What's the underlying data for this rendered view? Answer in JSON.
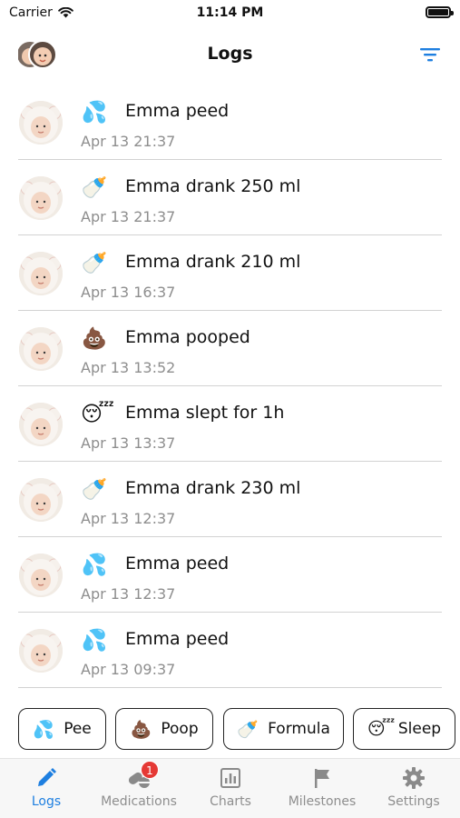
{
  "status_bar": {
    "carrier": "Carrier",
    "time": "11:14 PM"
  },
  "header": {
    "title": "Logs",
    "profile_icon": "baby-avatar-icon",
    "filter_icon": "filter-icon"
  },
  "logs": [
    {
      "emoji": "💦",
      "icon": "pee-icon",
      "text": "Emma peed",
      "time": "Apr 13 21:37"
    },
    {
      "emoji": "🍼",
      "icon": "bottle-icon",
      "text": "Emma drank 250 ml",
      "time": "Apr 13 21:37"
    },
    {
      "emoji": "🍼",
      "icon": "bottle-icon",
      "text": "Emma drank 210 ml",
      "time": "Apr 13 16:37"
    },
    {
      "emoji": "💩",
      "icon": "poop-icon",
      "text": "Emma pooped",
      "time": "Apr 13 13:52"
    },
    {
      "emoji": "😴",
      "icon": "sleep-icon",
      "text": "Emma slept for 1h",
      "time": "Apr 13 13:37"
    },
    {
      "emoji": "🍼",
      "icon": "bottle-icon",
      "text": "Emma drank 230 ml",
      "time": "Apr 13 12:37"
    },
    {
      "emoji": "💦",
      "icon": "pee-icon",
      "text": "Emma peed",
      "time": "Apr 13 12:37"
    },
    {
      "emoji": "💦",
      "icon": "pee-icon",
      "text": "Emma peed",
      "time": "Apr 13 09:37"
    }
  ],
  "quick_actions": [
    {
      "emoji": "💦",
      "icon": "pee-icon",
      "label": "Pee"
    },
    {
      "emoji": "💩",
      "icon": "poop-icon",
      "label": "Poop"
    },
    {
      "emoji": "🍼",
      "icon": "bottle-icon",
      "label": "Formula"
    },
    {
      "emoji": "😴",
      "icon": "sleep-icon",
      "label": "Sleep"
    }
  ],
  "tabs": [
    {
      "label": "Logs",
      "icon": "pencil-icon",
      "active": true
    },
    {
      "label": "Medications",
      "icon": "pill-icon",
      "badge": "1"
    },
    {
      "label": "Charts",
      "icon": "chart-icon"
    },
    {
      "label": "Milestones",
      "icon": "flag-icon"
    },
    {
      "label": "Settings",
      "icon": "gear-icon"
    }
  ],
  "colors": {
    "accent": "#1e7fe0",
    "badge": "#e53935",
    "muted": "#8e8e8e",
    "divider": "#d2d2d2"
  }
}
